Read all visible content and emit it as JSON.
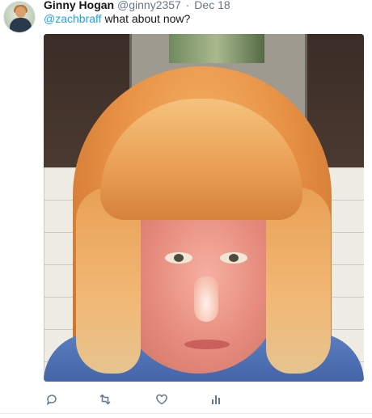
{
  "tweet": {
    "author_name": "Ginny Hogan",
    "author_handle": "@ginny2357",
    "separator": "·",
    "timestamp": "Dec 18",
    "mention": "@zachbraff",
    "body": "what about now?"
  },
  "actions": {
    "reply_icon": "reply-icon",
    "retweet_icon": "retweet-icon",
    "like_icon": "heart-icon",
    "analytics_icon": "analytics-icon"
  },
  "colors": {
    "link": "#1da1f2",
    "muted": "#657786",
    "text": "#14171a",
    "icon": "#657786"
  }
}
